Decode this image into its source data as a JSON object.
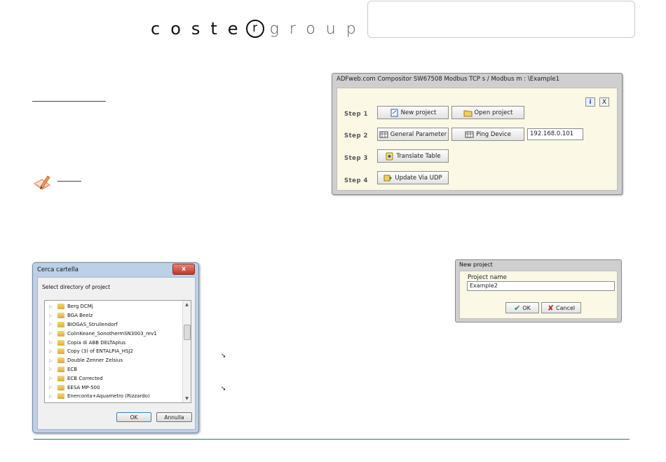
{
  "logo": {
    "left_word": "coste",
    "circle_letter": "r",
    "right_word": "group"
  },
  "compositor": {
    "title": "ADFweb.com Compositor SW67508 Modbus TCP s / Modbus m : \\Example1",
    "info_button": "i",
    "close_button": "X",
    "steps": [
      "Step 1",
      "Step 2",
      "Step 3",
      "Step 4"
    ],
    "buttons": {
      "new_project": "New project",
      "open_project": "Open project",
      "general_parameter": "General Parameter",
      "ping_device": "Ping Device",
      "translate_table": "Translate Table",
      "update_via_udp": "Update Via UDP"
    },
    "ip_value": "192.168.0.101"
  },
  "folder_dialog": {
    "title": "Cerca cartella",
    "close_glyph": "x",
    "label": "Select directory of project",
    "folders": [
      "Berg DCMj",
      "BGA Beelz",
      "BIOGAS_Strullendorf",
      "ColinKeane_SonothermSN3003_rev1",
      "Copia di ABB DELTAplus",
      "Copy (3) of ENTALPIA_HSJ2",
      "Double Zenner Zelsius",
      "ECB",
      "ECB Corrected",
      "EESA MP-500",
      "Enerconta+Aquametro (Rizzardo)"
    ],
    "ok": "OK",
    "cancel": "Annulla"
  },
  "new_project_dialog": {
    "title": "New project",
    "label": "Project name",
    "value": "Example2",
    "ok": "OK",
    "cancel": "Cancel"
  },
  "colors": {
    "footer_rule": "#2f7560",
    "window_body": "#fbf8e6",
    "dialog_frame": "#bcd0e6"
  }
}
